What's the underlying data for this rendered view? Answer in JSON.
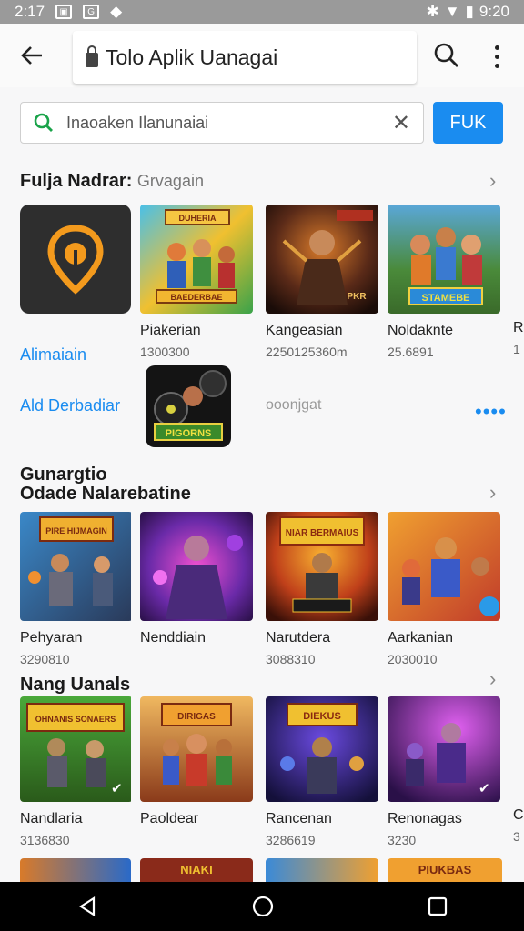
{
  "status": {
    "time": "2:17",
    "right_time": "9:20"
  },
  "appbar": {
    "title": "Tolo Aplik Uanagai"
  },
  "search": {
    "value": "Inaoaken Ilanunaiai",
    "button": "FUK"
  },
  "sections": [
    {
      "title": "Fulja Nadrar:",
      "subtitle": "Grvagain",
      "items": [
        {
          "title": "",
          "sub": ""
        },
        {
          "title": "Piakerian",
          "sub": "1300300"
        },
        {
          "title": "Kangeasian",
          "sub": "2250125360m"
        },
        {
          "title": "Noldaknte",
          "sub": "25.6891"
        }
      ]
    }
  ],
  "side_links": {
    "link1": "Alimaiain",
    "link2": "Ald Derbadiar",
    "gray": "ooonjgat",
    "more": "••••"
  },
  "section2": {
    "title_line1": "Gunargtio",
    "title_line2": "Odade Nalarebatine",
    "items": [
      {
        "title": "Pehyaran",
        "sub": "3290810",
        "art": "PIRE HIJMAGIN"
      },
      {
        "title": "Nenddiain",
        "sub": "",
        "art": ""
      },
      {
        "title": "Narutdera",
        "sub": "3088310",
        "art": "NIAR BERMAIUS"
      },
      {
        "title": "Aarkanian",
        "sub": "2030010",
        "art": ""
      }
    ]
  },
  "section3": {
    "title": "Nang Uanals",
    "items": [
      {
        "title": "Nandlaria",
        "sub": "3136830",
        "art": "OHNANIS SONAERS"
      },
      {
        "title": "Paoldear",
        "sub": "",
        "art": "DIRIGAS"
      },
      {
        "title": "Rancenan",
        "sub": "3286619",
        "art": "DIEKUS"
      },
      {
        "title": "Renonagas",
        "sub": "3230",
        "art": ""
      }
    ]
  },
  "row1_art": {
    "card2": "DUHERIA",
    "card2b": "BAEDERBAE",
    "card4": "STAMEBE",
    "badge": "PIGORNS"
  },
  "peek": {
    "r": "R",
    "one": "1",
    "c": "C",
    "three": "3"
  },
  "bottom_art": {
    "card2": "NIAKI",
    "card4": "PIUKBAS"
  }
}
